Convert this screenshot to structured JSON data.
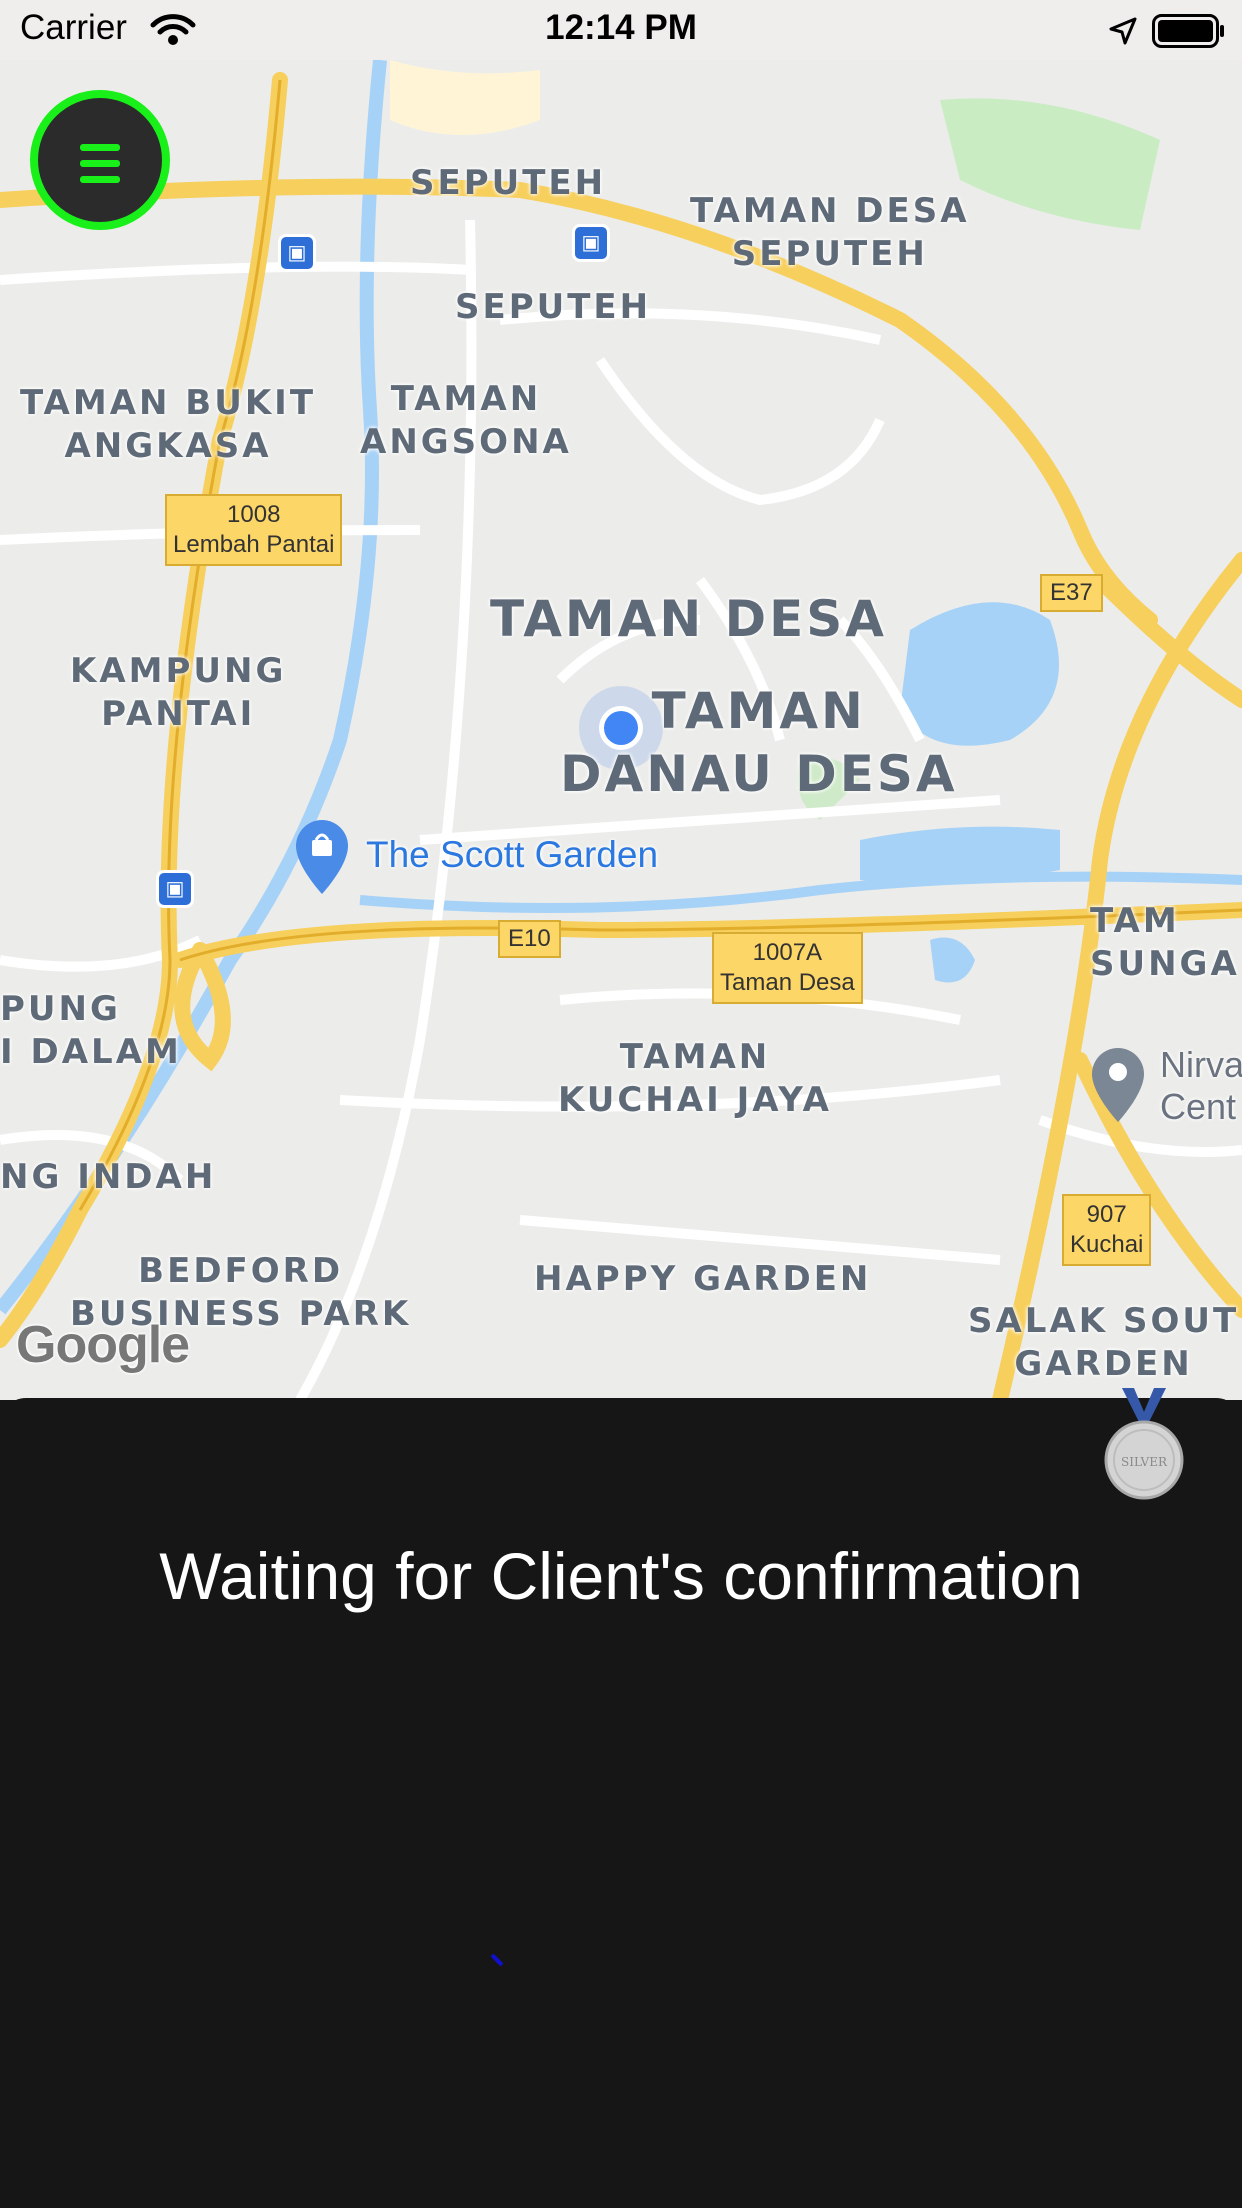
{
  "status_bar": {
    "carrier": "Carrier",
    "time": "12:14 PM"
  },
  "map": {
    "provider": "Google",
    "area_labels": [
      "SEPUTEH",
      "TAMAN DESA\nSEPUTEH",
      "SEPUTEH",
      "TAMAN BUKIT\nANGKASA",
      "TAMAN\nANGSONA",
      "TAMAN DESA",
      "TAMAN\nDANAU DESA",
      "KAMPUNG\nPANTAI",
      "TAMAN\nKUCHAI JAYA",
      "PUNG\nI DALAM",
      "NG INDAH",
      "BEDFORD\nBUSINESS PARK",
      "HAPPY GARDEN",
      "SALAK SOUT\nGARDEN",
      "TAM\nSUNGA"
    ],
    "road_shields": [
      "1008\nLembah Pantai",
      "E37",
      "E10",
      "1007A\nTaman Desa",
      "907\nKuchai"
    ],
    "pois": [
      "The Scott Garden",
      "Nirva\nCent"
    ]
  },
  "sheet": {
    "title": "Waiting for Client's confirmation",
    "badge": "SILVER"
  },
  "colors": {
    "accent": "#19f01a",
    "sheet_bg": "#161616",
    "user_dot": "#4285f4"
  }
}
